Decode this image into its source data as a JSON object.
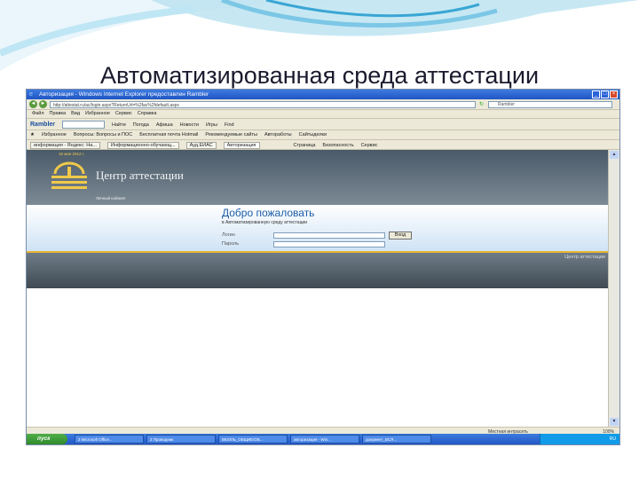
{
  "slide": {
    "title": "Автоматизированная среда аттестации"
  },
  "window": {
    "title": "Авторизация - Windows Internet Explorer предоставлен Rambler"
  },
  "address_bar": {
    "url": "http://attestat.ru/ac/login.aspx?ReturnUrl=%2fac%2fdefault.aspx",
    "search_placeholder": "Rambler"
  },
  "menu": [
    "Файл",
    "Правка",
    "Вид",
    "Избранное",
    "Сервис",
    "Справка"
  ],
  "toolbar1": {
    "rambler": "Rambler",
    "find": "Найти",
    "items": [
      "Погода",
      "Афиша",
      "Новости",
      "Игры",
      "Find"
    ]
  },
  "toolbar2": {
    "favorites": "Избранное",
    "items": [
      "Вопросы: Вопросы и ПОС",
      "Бесплатная почта Hotmail",
      "Рекомендуемые сайты",
      "Автоработы",
      "Сайтыделки"
    ]
  },
  "tabs": [
    "информация - Яндекс: На...",
    "Информационно-обучающ...",
    "Ауд.ЕИАС",
    "Авторизация"
  ],
  "tab_tools": [
    "Страница",
    "Безопасность",
    "Сервис"
  ],
  "site": {
    "date": "15 мая 2012 г.",
    "brand": "Центр аттестации",
    "cabinet": "Личный кабинет",
    "welcome": "Добро пожаловать",
    "subtitle": "в Автоматизированную среду аттестации",
    "login_label": "Логин",
    "password_label": "Пароль",
    "login_button": "Вход",
    "footer": "Центр аттестации"
  },
  "status": {
    "zone": "Местная интрасеть",
    "zoom": "100%"
  },
  "taskbar": {
    "start": "пуск",
    "tasks": [
      "2 Microsoft Office...",
      "2 Проводник",
      "ВКЛ/ЛЬ_ОБЩИЕ/ОБ...",
      "авторизация - Win...",
      "документ_ВСЯ..."
    ],
    "tray": "RU"
  },
  "colors": {
    "banner": "#4a5a68",
    "welcome_text": "#1d5ea8",
    "accent_gold": "#e9b733"
  }
}
